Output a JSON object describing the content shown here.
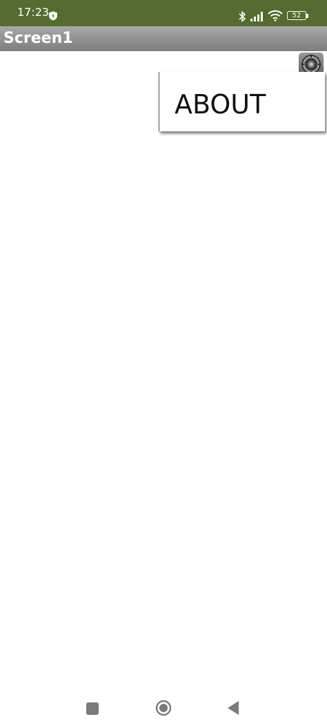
{
  "status_bar": {
    "time": "17:23",
    "battery": "52",
    "icons": [
      "shield-icon",
      "bluetooth-icon",
      "signal-icon",
      "wifi-icon",
      "battery-icon"
    ]
  },
  "app_bar": {
    "title": "Screen1"
  },
  "menu": {
    "items": [
      {
        "label": "ABOUT"
      }
    ]
  },
  "nav_bar": {
    "icons": [
      "recents-icon",
      "home-icon",
      "back-icon"
    ]
  },
  "colors": {
    "status_bar_bg": "#556b2f",
    "title_bar_bg": "#8f8f8f",
    "background": "#ffffff"
  }
}
